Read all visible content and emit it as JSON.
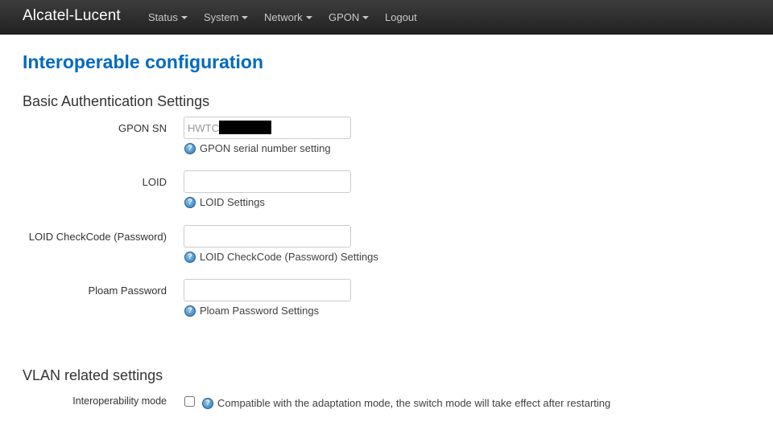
{
  "navbar": {
    "brand": "Alcatel-Lucent",
    "menu": [
      {
        "label": "Status",
        "dropdown": true
      },
      {
        "label": "System",
        "dropdown": true
      },
      {
        "label": "Network",
        "dropdown": true
      },
      {
        "label": "GPON",
        "dropdown": true
      },
      {
        "label": "Logout",
        "dropdown": false
      }
    ]
  },
  "page": {
    "title": "Interoperable configuration"
  },
  "basic_auth": {
    "heading": "Basic Authentication Settings",
    "gpon_sn": {
      "label": "GPON SN",
      "value": "HWTC",
      "help": "GPON serial number setting",
      "redacted": true
    },
    "loid": {
      "label": "LOID",
      "value": "",
      "help": "LOID Settings"
    },
    "loid_checkcode": {
      "label": "LOID CheckCode (Password)",
      "value": "",
      "help": "LOID CheckCode (Password) Settings"
    },
    "ploam_password": {
      "label": "Ploam Password",
      "value": "",
      "help": "Ploam Password Settings"
    }
  },
  "vlan": {
    "heading": "VLAN related settings",
    "interoperability_mode": {
      "label": "Interoperability mode",
      "checked": false,
      "help": "Compatible with the adaptation mode, the switch mode will take effect after restarting"
    }
  },
  "colors": {
    "title_blue": "#0069c0",
    "navbar_bg": "#222222",
    "help_icon": "#2f79b7"
  },
  "icons": {
    "help": "help-circle-icon",
    "dropdown": "caret-down-icon"
  }
}
